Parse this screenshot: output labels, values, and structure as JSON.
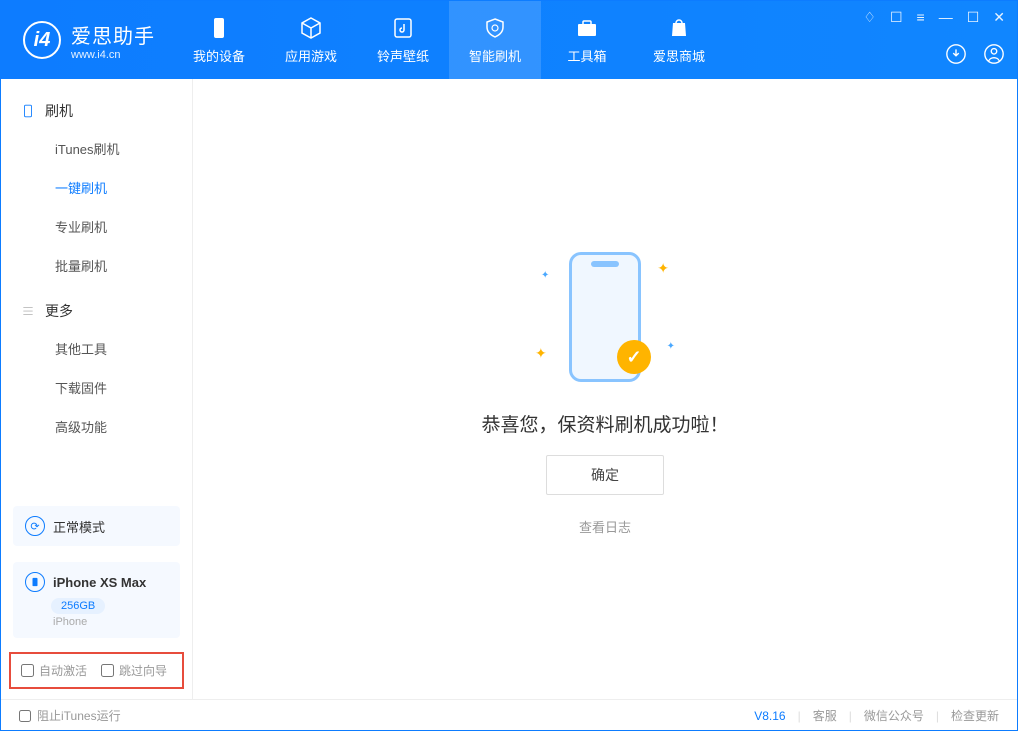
{
  "app": {
    "name_cn": "爱思助手",
    "name_en": "www.i4.cn"
  },
  "tabs": [
    {
      "label": "我的设备"
    },
    {
      "label": "应用游戏"
    },
    {
      "label": "铃声壁纸"
    },
    {
      "label": "智能刷机"
    },
    {
      "label": "工具箱"
    },
    {
      "label": "爱思商城"
    }
  ],
  "sidebar": {
    "section1_title": "刷机",
    "items": [
      {
        "label": "iTunes刷机"
      },
      {
        "label": "一键刷机"
      },
      {
        "label": "专业刷机"
      },
      {
        "label": "批量刷机"
      }
    ],
    "section2_title": "更多",
    "items2": [
      {
        "label": "其他工具"
      },
      {
        "label": "下载固件"
      },
      {
        "label": "高级功能"
      }
    ]
  },
  "mode": {
    "label": "正常模式"
  },
  "device": {
    "name": "iPhone XS Max",
    "storage": "256GB",
    "type": "iPhone"
  },
  "checkboxes": {
    "auto_activate": "自动激活",
    "skip_guide": "跳过向导"
  },
  "main": {
    "success_message": "恭喜您，保资料刷机成功啦！",
    "ok_button": "确定",
    "view_log": "查看日志"
  },
  "footer": {
    "block_itunes": "阻止iTunes运行",
    "version": "V8.16",
    "customer_service": "客服",
    "wechat": "微信公众号",
    "check_update": "检查更新"
  }
}
